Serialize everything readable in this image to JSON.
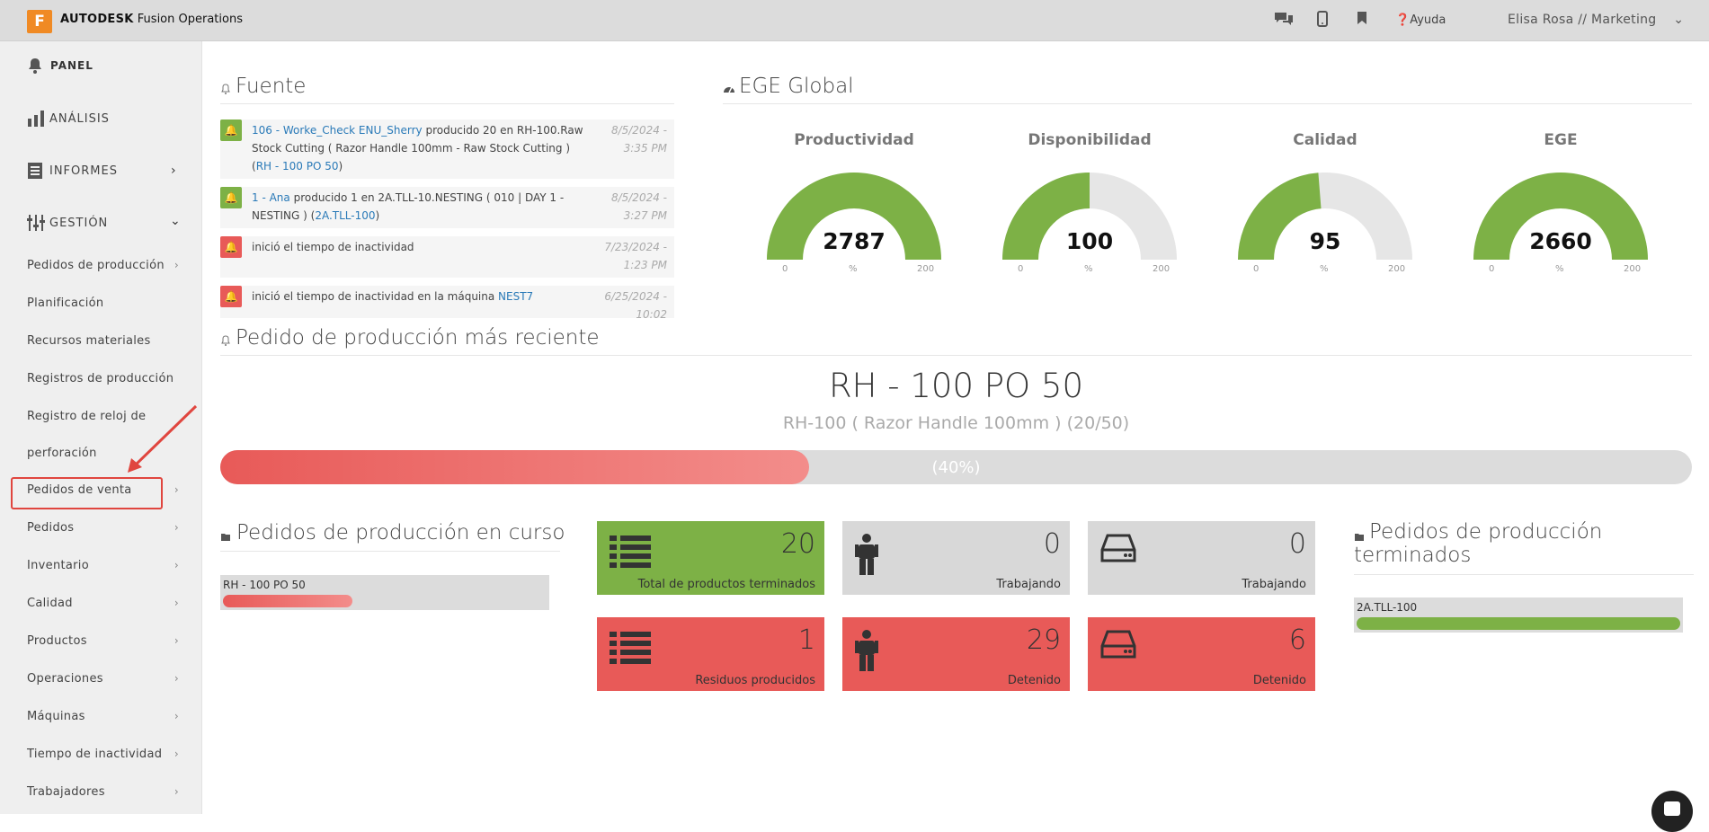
{
  "header": {
    "logo_letter": "F",
    "brand_bold": "AUTODESK",
    "brand_rest": " Fusion Operations",
    "help": "Ayuda",
    "user": "Elisa Rosa // Marketing"
  },
  "sidebar": {
    "panel": "PANEL",
    "analisis": "ANÁLISIS",
    "informes": "INFORMES",
    "gestion": "GESTIÓN",
    "items": [
      "Pedidos de producción",
      "Planificación",
      "Recursos materiales",
      "Registros de producción",
      "Registro de reloj de",
      "perforación",
      "Pedidos de venta",
      "Pedidos",
      "Inventario",
      "Calidad",
      "Productos",
      "Operaciones",
      "Máquinas",
      "Tiempo de inactividad",
      "Trabajadores"
    ]
  },
  "feed": {
    "title": "Fuente",
    "items": [
      {
        "link1": "106 - Worke_Check ENU_Sherry",
        "text1": " producido 20 en RH-100.Raw Stock Cutting ( Razor Handle 100mm - Raw Stock Cutting ) (",
        "link2": "RH - 100 PO 50",
        "text2": ")",
        "date": "8/5/2024 - 3:35 PM",
        "status": "green"
      },
      {
        "link1": "1 - Ana",
        "text1": " producido 1 en 2A.TLL-10.NESTING ( 010 | DAY 1 - NESTING ) (",
        "link2": "2A.TLL-100",
        "text2": ")",
        "date": "8/5/2024 - 3:27 PM",
        "status": "green"
      },
      {
        "link1": "",
        "text1": "inició el tiempo de inactividad",
        "link2": "",
        "text2": "",
        "date": "7/23/2024 - 1:23 PM",
        "status": "red"
      },
      {
        "link1": "",
        "text1": "inició el tiempo de inactividad en la máquina ",
        "link2": "NEST7",
        "text2": "",
        "date": "6/25/2024 - 10:02",
        "status": "red"
      }
    ]
  },
  "oee": {
    "title": "EGE Global",
    "gauges": [
      {
        "title": "Productividad",
        "value": "2787",
        "fill": 1.0,
        "min": "0",
        "max": "200",
        "unit": "%"
      },
      {
        "title": "Disponibilidad",
        "value": "100",
        "fill": 0.5,
        "min": "0",
        "max": "200",
        "unit": "%"
      },
      {
        "title": "Calidad",
        "value": "95",
        "fill": 0.475,
        "min": "0",
        "max": "200",
        "unit": "%"
      },
      {
        "title": "EGE",
        "value": "2660",
        "fill": 1.0,
        "min": "0",
        "max": "200",
        "unit": "%"
      }
    ]
  },
  "recent": {
    "title": "Pedido de producción más reciente",
    "order": "RH - 100 PO 50",
    "subtitle": "RH-100 ( Razor Handle 100mm ) (20/50)",
    "progress_label": "(40%)",
    "progress": 0.4
  },
  "inprogress": {
    "title": "Pedidos de producción en curso",
    "items": [
      {
        "label": "RH - 100 PO 50",
        "progress": 0.4
      }
    ]
  },
  "tiles": [
    {
      "value": "20",
      "label": "Total de productos terminados",
      "color": "#7db146",
      "icon": "list-icon"
    },
    {
      "value": "0",
      "label": "Trabajando",
      "color": "#d8d8d8",
      "icon": "worker-icon"
    },
    {
      "value": "0",
      "label": "Trabajando",
      "color": "#d8d8d8",
      "icon": "machine-icon"
    },
    {
      "value": "1",
      "label": "Residuos producidos",
      "color": "#e85a58",
      "icon": "list-icon"
    },
    {
      "value": "29",
      "label": "Detenido",
      "color": "#e85a58",
      "icon": "worker-icon"
    },
    {
      "value": "6",
      "label": "Detenido",
      "color": "#e85a58",
      "icon": "machine-icon"
    }
  ],
  "finished": {
    "title_line1": "Pedidos de producción",
    "title_line2": "terminados",
    "items": [
      {
        "label": "2A.TLL-100",
        "progress": 1.0
      }
    ]
  }
}
